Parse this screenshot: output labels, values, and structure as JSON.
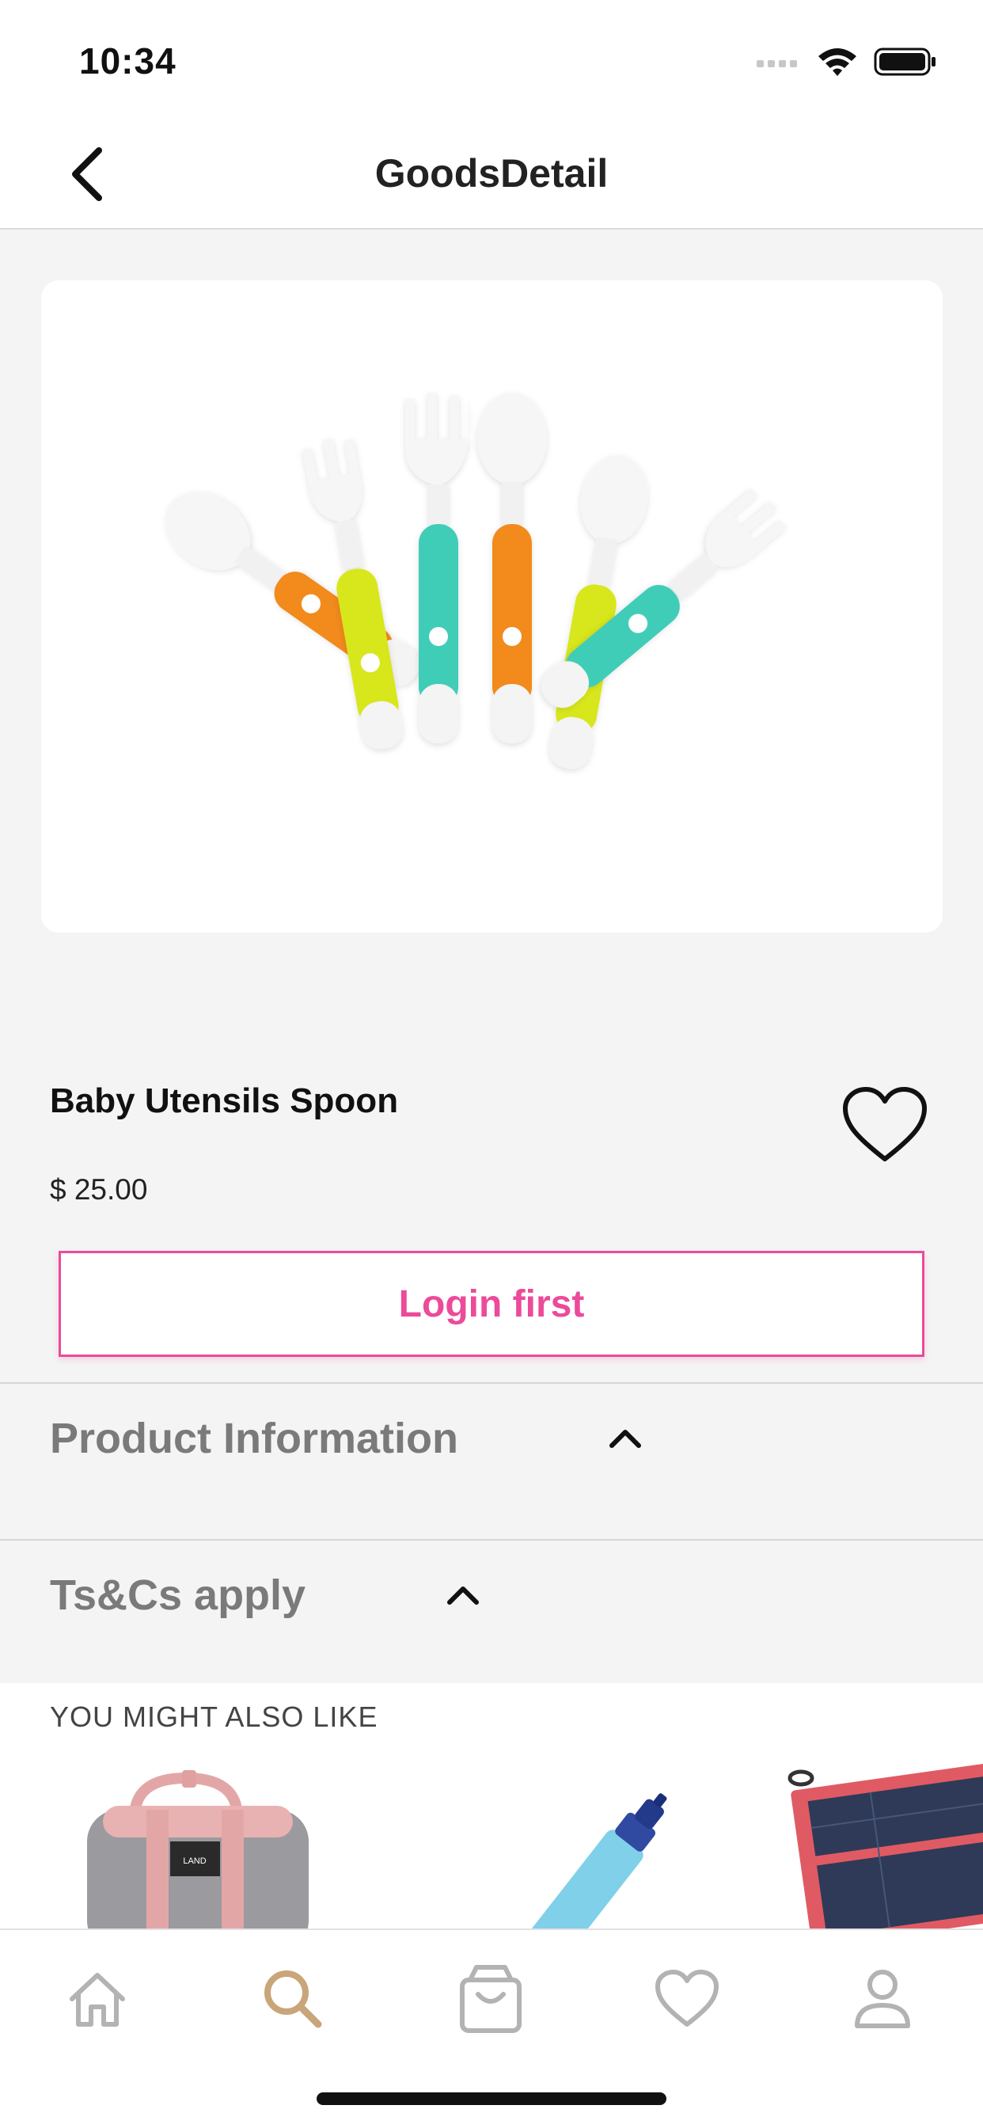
{
  "status": {
    "time": "10:34"
  },
  "nav": {
    "title": "GoodsDetail"
  },
  "product": {
    "name": "Baby Utensils Spoon",
    "price": "$ 25.00"
  },
  "actions": {
    "login_label": "Login first"
  },
  "sections": [
    {
      "label": "Product Information"
    },
    {
      "label": "Ts&Cs apply"
    }
  ],
  "recommendations": {
    "title": "YOU MIGHT ALSO LIKE",
    "items": [
      {
        "icon": "backpack-image",
        "logo": "LAND"
      },
      {
        "icon": "water-filter-image"
      },
      {
        "icon": "solar-panel-image"
      }
    ]
  },
  "tabbar": {
    "items": [
      {
        "icon": "home-icon"
      },
      {
        "icon": "search-icon",
        "active": true
      },
      {
        "icon": "bag-icon"
      },
      {
        "icon": "heart-icon"
      },
      {
        "icon": "profile-icon"
      }
    ]
  },
  "colors": {
    "accent": "#ec4a9a",
    "tab_active": "#c9a57a",
    "tab_inactive": "#b3b3b3",
    "orange": "#f28a1c",
    "lime": "#d8e61c",
    "teal": "#3fcdb8"
  }
}
